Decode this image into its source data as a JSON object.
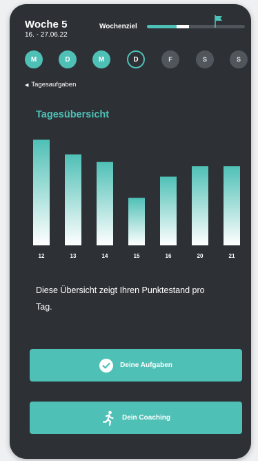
{
  "header": {
    "week_title": "Woche 5",
    "date_range": "16. - 27.06.22",
    "goal_label": "Wochenziel",
    "goal_progress": 0.43,
    "goal_today_segment": 0.13,
    "flag_icon": "flag-icon"
  },
  "days": [
    {
      "label": "M",
      "state": "done"
    },
    {
      "label": "D",
      "state": "done"
    },
    {
      "label": "M",
      "state": "done"
    },
    {
      "label": "D",
      "state": "current"
    },
    {
      "label": "F",
      "state": "future"
    },
    {
      "label": "S",
      "state": "future"
    },
    {
      "label": "S",
      "state": "future"
    }
  ],
  "back_link": {
    "label": "Tagesaufgaben",
    "icon": "chevron-left-icon"
  },
  "section_title": "Tagesübersicht",
  "chart_data": {
    "type": "bar",
    "categories": [
      "12",
      "13",
      "14",
      "15",
      "16",
      "20",
      "21"
    ],
    "values": [
      100,
      86,
      79,
      45,
      65,
      75,
      75
    ],
    "ylim": [
      0,
      100
    ],
    "title": "",
    "xlabel": "",
    "ylabel": "",
    "grid": false,
    "colors": {
      "top": "#4fc0b6",
      "bottom": "#ffffff"
    }
  },
  "description": "Diese Übersicht zeigt Ihren Punktestand pro Tag.",
  "buttons": {
    "tasks": {
      "label": "Deine Aufgaben",
      "icon": "check-circle-icon"
    },
    "coaching": {
      "label": "Dein Coaching",
      "icon": "running-person-icon"
    }
  },
  "colors": {
    "accent": "#4fc0b6",
    "background": "#2d3136",
    "future_day": "#50565c"
  }
}
